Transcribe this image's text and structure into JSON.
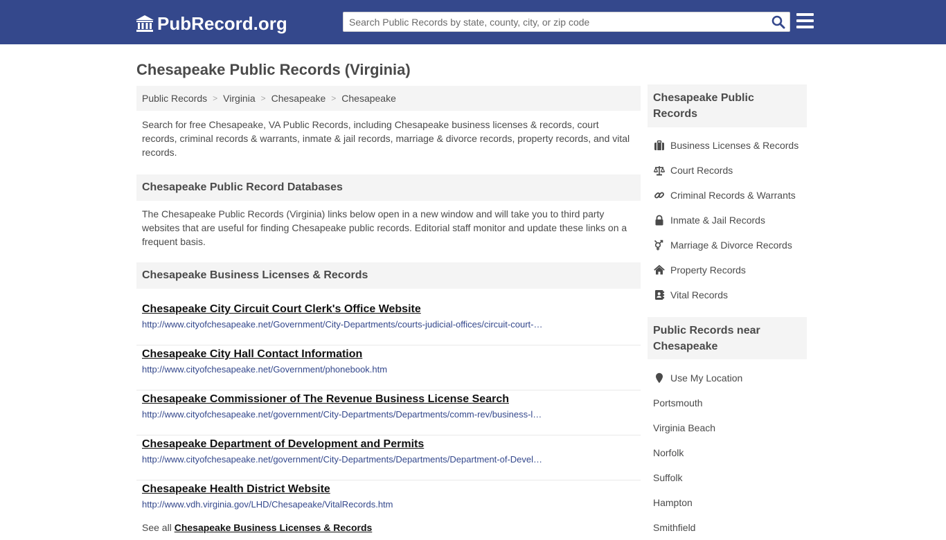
{
  "header": {
    "logo_text": "PubRecord.org",
    "search_placeholder": "Search Public Records by state, county, city, or zip code",
    "brand_color": "#34488c"
  },
  "page_title": "Chesapeake Public Records (Virginia)",
  "breadcrumb": [
    {
      "label": "Public Records"
    },
    {
      "label": "Virginia"
    },
    {
      "label": "Chesapeake"
    },
    {
      "label": "Chesapeake"
    }
  ],
  "intro": "Search for free Chesapeake, VA Public Records, including Chesapeake business licenses & records, court records, criminal records & warrants, inmate & jail records, marriage & divorce records, property records, and vital records.",
  "databases": {
    "heading": "Chesapeake Public Record Databases",
    "text": "The Chesapeake Public Records (Virginia) links below open in a new window and will take you to third party websites that are useful for finding Chesapeake public records. Editorial staff monitor and update these links on a frequent basis."
  },
  "business": {
    "heading": "Chesapeake Business Licenses & Records",
    "links": [
      {
        "title": "Chesapeake City Circuit Court Clerk's Office Website",
        "url": "http://www.cityofchesapeake.net/Government/City-Departments/courts-judicial-offices/circuit-court-clerk"
      },
      {
        "title": "Chesapeake City Hall Contact Information",
        "url": "http://www.cityofchesapeake.net/Government/phonebook.htm"
      },
      {
        "title": "Chesapeake Commissioner of The Revenue Business License Search",
        "url": "http://www.cityofchesapeake.net/government/City-Departments/Departments/comm-rev/business-license"
      },
      {
        "title": "Chesapeake Department of Development and Permits",
        "url": "http://www.cityofchesapeake.net/government/City-Departments/Departments/Department-of-Development"
      },
      {
        "title": "Chesapeake Health District Website",
        "url": "http://www.vdh.virginia.gov/LHD/Chesapeake/VitalRecords.htm"
      }
    ],
    "see_all_prefix": "See all",
    "see_all_link": "Chesapeake Business Licenses & Records"
  },
  "sidebar": {
    "heading": "Chesapeake Public Records",
    "items": [
      {
        "label": "Business Licenses & Records",
        "icon": "briefcase-icon"
      },
      {
        "label": "Court Records",
        "icon": "scale-icon"
      },
      {
        "label": "Criminal Records & Warrants",
        "icon": "link-icon"
      },
      {
        "label": "Inmate & Jail Records",
        "icon": "lock-icon"
      },
      {
        "label": "Marriage & Divorce Records",
        "icon": "gender-icon"
      },
      {
        "label": "Property Records",
        "icon": "home-icon"
      },
      {
        "label": "Vital Records",
        "icon": "address-book-icon"
      }
    ],
    "near_heading": "Public Records near Chesapeake",
    "use_location": "Use My Location",
    "near": [
      "Portsmouth",
      "Virginia Beach",
      "Norfolk",
      "Suffolk",
      "Hampton",
      "Smithfield"
    ]
  }
}
